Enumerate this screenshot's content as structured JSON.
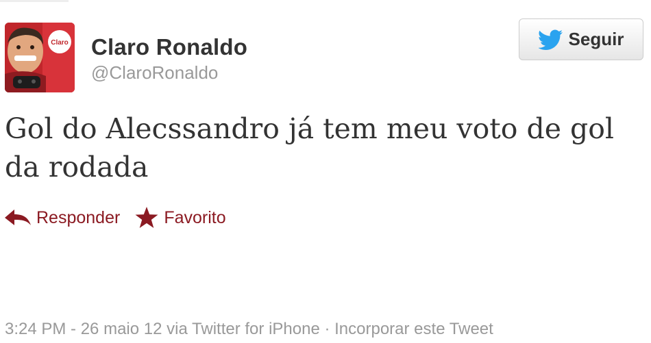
{
  "profile": {
    "display_name": "Claro Ronaldo",
    "screen_name": "@ClaroRonaldo",
    "avatar_badge": "Claro"
  },
  "follow_button": {
    "label": "Seguir",
    "icon": "twitter-bird-icon"
  },
  "tweet": {
    "text_line1": "Gol do Alecssandro já tem meu voto de gol",
    "text_line2": "da rodada"
  },
  "actions": {
    "reply_label": "Responder",
    "reply_icon": "reply-arrow-icon",
    "favorite_label": "Favorito",
    "favorite_icon": "star-icon"
  },
  "meta": {
    "time_date": "3:24 PM - 26 maio 12",
    "via_text": " via ",
    "source": "Twitter for iPhone",
    "separator": " · ",
    "embed_label": "Incorporar este Tweet"
  },
  "colors": {
    "action_red": "#8b1a22",
    "avatar_red": "#c0262b",
    "muted_gray": "#999999",
    "twitter_blue": "#2aa3ef"
  }
}
